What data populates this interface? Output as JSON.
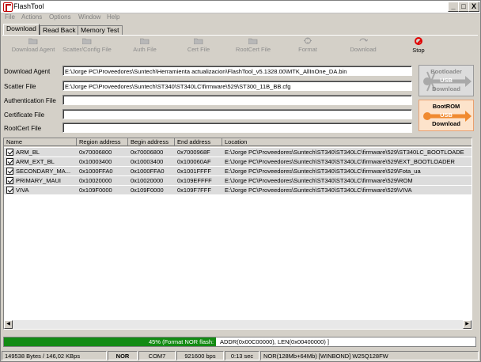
{
  "window": {
    "title": "FlashTool",
    "minimize": "_",
    "maximize": "□",
    "close": "X"
  },
  "menu": [
    "File",
    "Actions",
    "Options",
    "Window",
    "Help"
  ],
  "tabs": [
    "Download",
    "Read Back",
    "Memory Test"
  ],
  "toolbar": [
    {
      "label": "Download Agent",
      "icon": "folder-icon",
      "enabled": false
    },
    {
      "label": "Scatter/Config File",
      "icon": "folder-icon",
      "enabled": false
    },
    {
      "label": "Auth File",
      "icon": "folder-icon",
      "enabled": false
    },
    {
      "label": "Cert File",
      "icon": "folder-icon",
      "enabled": false
    },
    {
      "label": "RootCert File",
      "icon": "folder-icon",
      "enabled": false
    },
    {
      "label": "Format",
      "icon": "format-icon",
      "enabled": false
    },
    {
      "label": "Download",
      "icon": "download-icon",
      "enabled": false
    },
    {
      "label": "Stop",
      "icon": "stop-icon",
      "enabled": true
    }
  ],
  "fields": {
    "download_agent": {
      "label": "Download Agent",
      "value": "E:\\Jorge PC\\Proveedores\\Suntech\\Herramienta actualizacion\\FlashTool_v5.1328.00\\MTK_AllInOne_DA.bin"
    },
    "scatter_file": {
      "label": "Scatter File",
      "value": "E:\\Jorge PC\\Proveedores\\Suntech\\ST340\\ST340LC\\firmware\\529\\ST300_11B_BB.cfg"
    },
    "authentication_file": {
      "label": "Authentication File",
      "value": ""
    },
    "certificate_file": {
      "label": "Certificate File",
      "value": ""
    },
    "rootcert_file": {
      "label": "RootCert File",
      "value": ""
    }
  },
  "side_buttons": {
    "bootloader": [
      "Bootloader",
      "USB",
      "Download"
    ],
    "bootrom": [
      "BootROM",
      "USB",
      "Download"
    ]
  },
  "list_headers": [
    "Name",
    "Region address",
    "Begin address",
    "End address",
    "Location"
  ],
  "list_rows": [
    {
      "name": "ARM_BL",
      "region": "0x70006800",
      "begin": "0x70006800",
      "end": "0x7000968F",
      "location": "E:\\Jorge PC\\Proveedores\\Suntech\\ST340\\ST340LC\\firmware\\529\\ST340LC_BOOTLOADE",
      "checked": true
    },
    {
      "name": "ARM_EXT_BL",
      "region": "0x10003400",
      "begin": "0x10003400",
      "end": "0x100060AF",
      "location": "E:\\Jorge PC\\Proveedores\\Suntech\\ST340\\ST340LC\\firmware\\529\\EXT_BOOTLOADER",
      "checked": true
    },
    {
      "name": "SECONDARY_MA...",
      "region": "0x1000FFA0",
      "begin": "0x1000FFA0",
      "end": "0x1001FFFF",
      "location": "E:\\Jorge PC\\Proveedores\\Suntech\\ST340\\ST340LC\\firmware\\529\\Fota_ua",
      "checked": true
    },
    {
      "name": "PRIMARY_MAUI",
      "region": "0x10020000",
      "begin": "0x10020000",
      "end": "0x109EFFFF",
      "location": "E:\\Jorge PC\\Proveedores\\Suntech\\ST340\\ST340LC\\firmware\\529\\ROM",
      "checked": true
    },
    {
      "name": "VIVA",
      "region": "0x109F0000",
      "begin": "0x109F0000",
      "end": "0x109F7FFF",
      "location": "E:\\Jorge PC\\Proveedores\\Suntech\\ST340\\ST340LC\\firmware\\529\\VIVA",
      "checked": true
    }
  ],
  "progress": {
    "percent": 45,
    "label": "45% (Format NOR flash:",
    "detail": "ADDR(0x00C00000), LEN(0x00400000) ]",
    "color": "#138b13"
  },
  "status": {
    "bytes": "149538 Bytes / 146,02 KBps",
    "type": "NOR",
    "port": "COM7",
    "baud": "921600 bps",
    "time": "0:13 sec",
    "flash": "NOR(128Mb+64Mb) [WINBOND] W25Q128FW"
  }
}
